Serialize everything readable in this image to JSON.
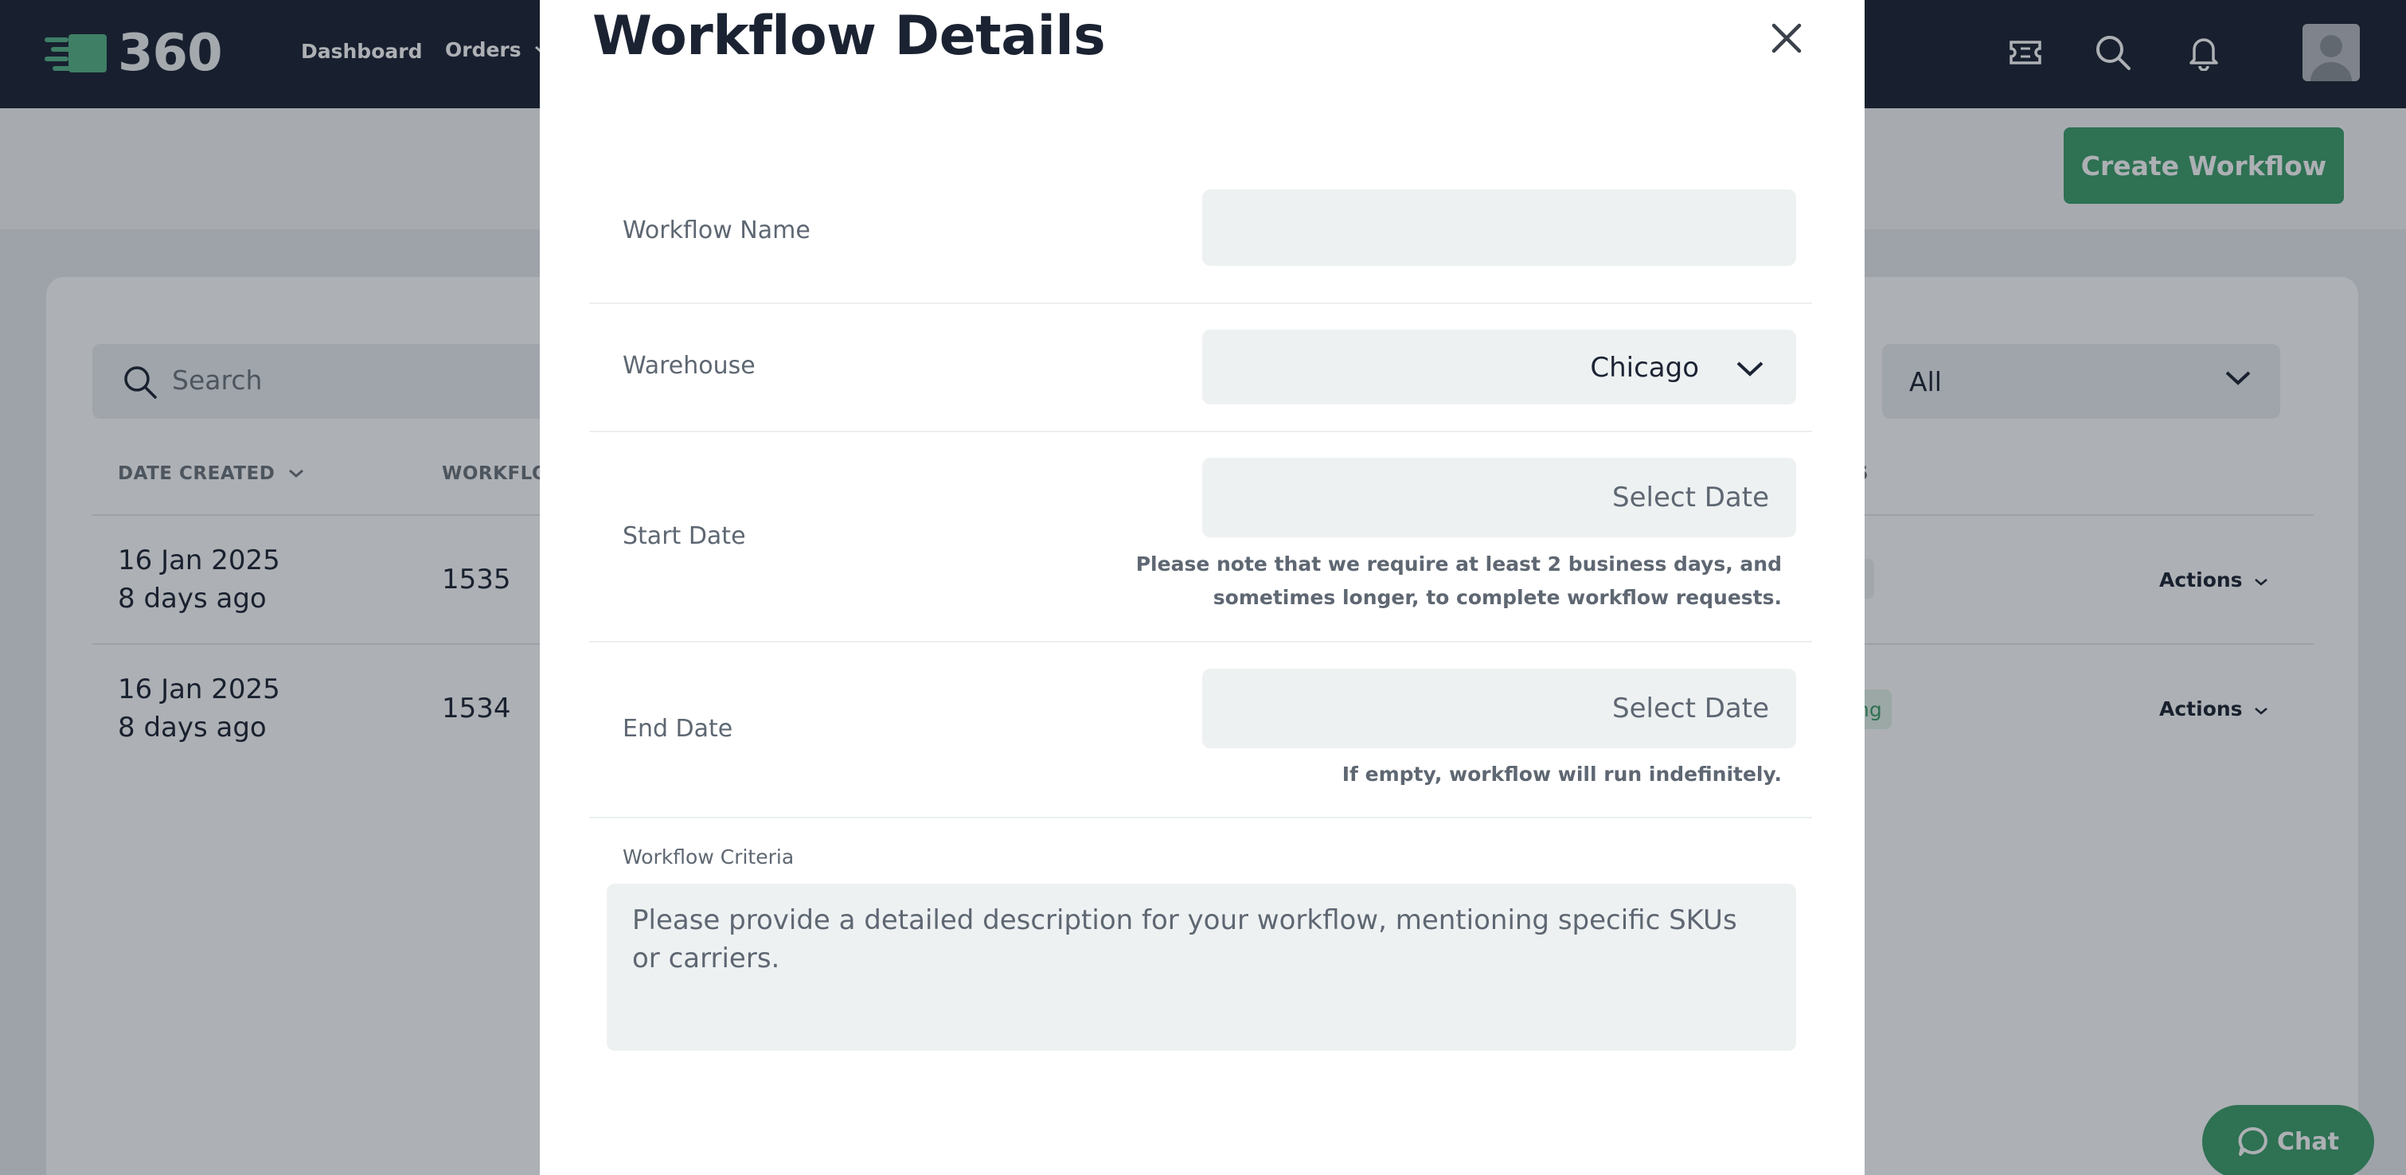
{
  "app": {
    "logo_text": "360",
    "nav": {
      "dashboard": "Dashboard",
      "orders": "Orders"
    }
  },
  "page": {
    "create_button": "Create Workflow",
    "search_placeholder": "Search",
    "filter_value": "All",
    "columns": {
      "date_created": "DATE CREATED",
      "workflow": "WORKFLOW",
      "status_partial": "S"
    },
    "rows": [
      {
        "date": "16 Jan 2025",
        "relative": "8 days ago",
        "id": "1535",
        "status": "",
        "actions": "Actions"
      },
      {
        "date": "16 Jan 2025",
        "relative": "8 days ago",
        "id": "1534",
        "status": "ng",
        "actions": "Actions"
      }
    ],
    "chat_label": "Chat"
  },
  "modal": {
    "title": "Workflow Details",
    "workflow_name": {
      "label": "Workflow Name",
      "value": ""
    },
    "warehouse": {
      "label": "Warehouse",
      "value": "Chicago"
    },
    "start_date": {
      "label": "Start Date",
      "placeholder": "Select Date",
      "note_line1": "Please note that we require at least 2 business days, and",
      "note_line2": "sometimes longer, to complete workflow requests."
    },
    "end_date": {
      "label": "End Date",
      "placeholder": "Select Date",
      "note": "If empty, workflow will run indefinitely."
    },
    "criteria": {
      "label": "Workflow Criteria",
      "placeholder": "Please provide a detailed description for your workflow, mentioning specific SKUs or carriers."
    }
  },
  "colors": {
    "nav_bg": "#1b2333",
    "accent_green": "#3d9f6b",
    "field_bg": "#eef1f2"
  }
}
